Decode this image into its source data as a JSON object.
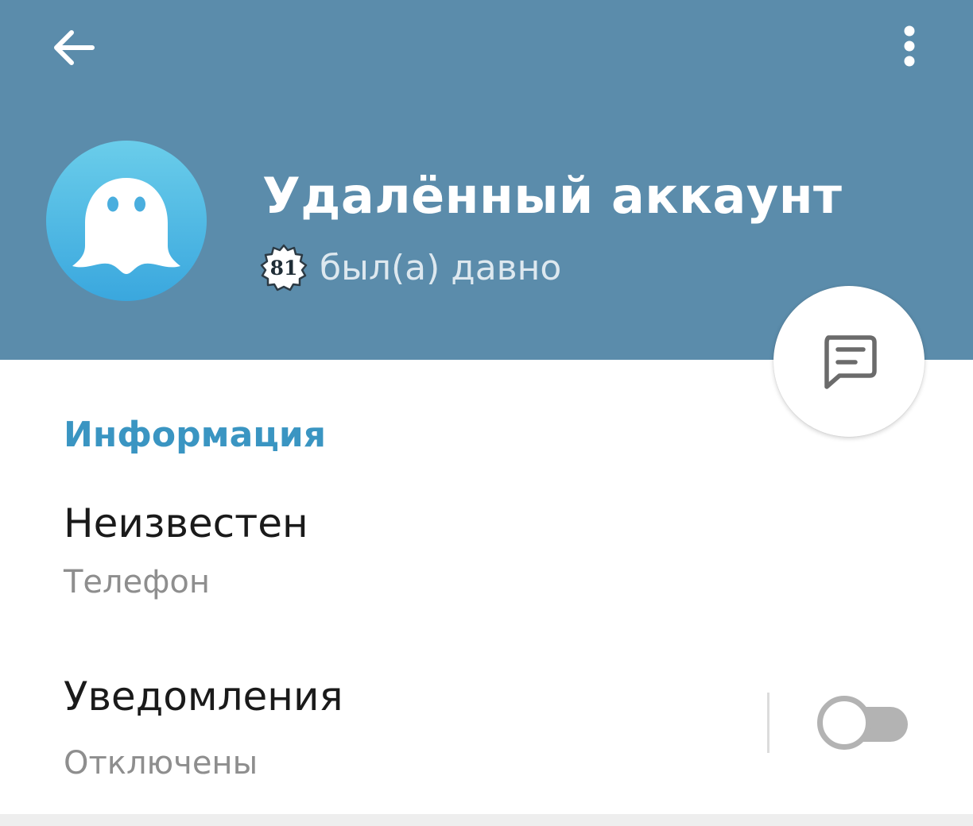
{
  "header": {
    "background_color": "#5b8cab",
    "back_icon": "arrow-left-icon",
    "menu_icon": "more-vertical-icon"
  },
  "profile": {
    "avatar_icon": "ghost-icon",
    "name": "Удалённый аккаунт",
    "badge_number": "81",
    "status": "был(а) давно"
  },
  "fab": {
    "icon": "message-icon"
  },
  "info_section": {
    "title": "Информация",
    "phone": {
      "value": "Неизвестен",
      "label": "Телефон"
    },
    "notifications": {
      "value": "Уведомления",
      "label": "Отключены",
      "enabled": false
    }
  },
  "colors": {
    "accent": "#3a95c2",
    "avatar_gradient_top": "#6acdea",
    "avatar_gradient_bottom": "#3aa7de"
  }
}
